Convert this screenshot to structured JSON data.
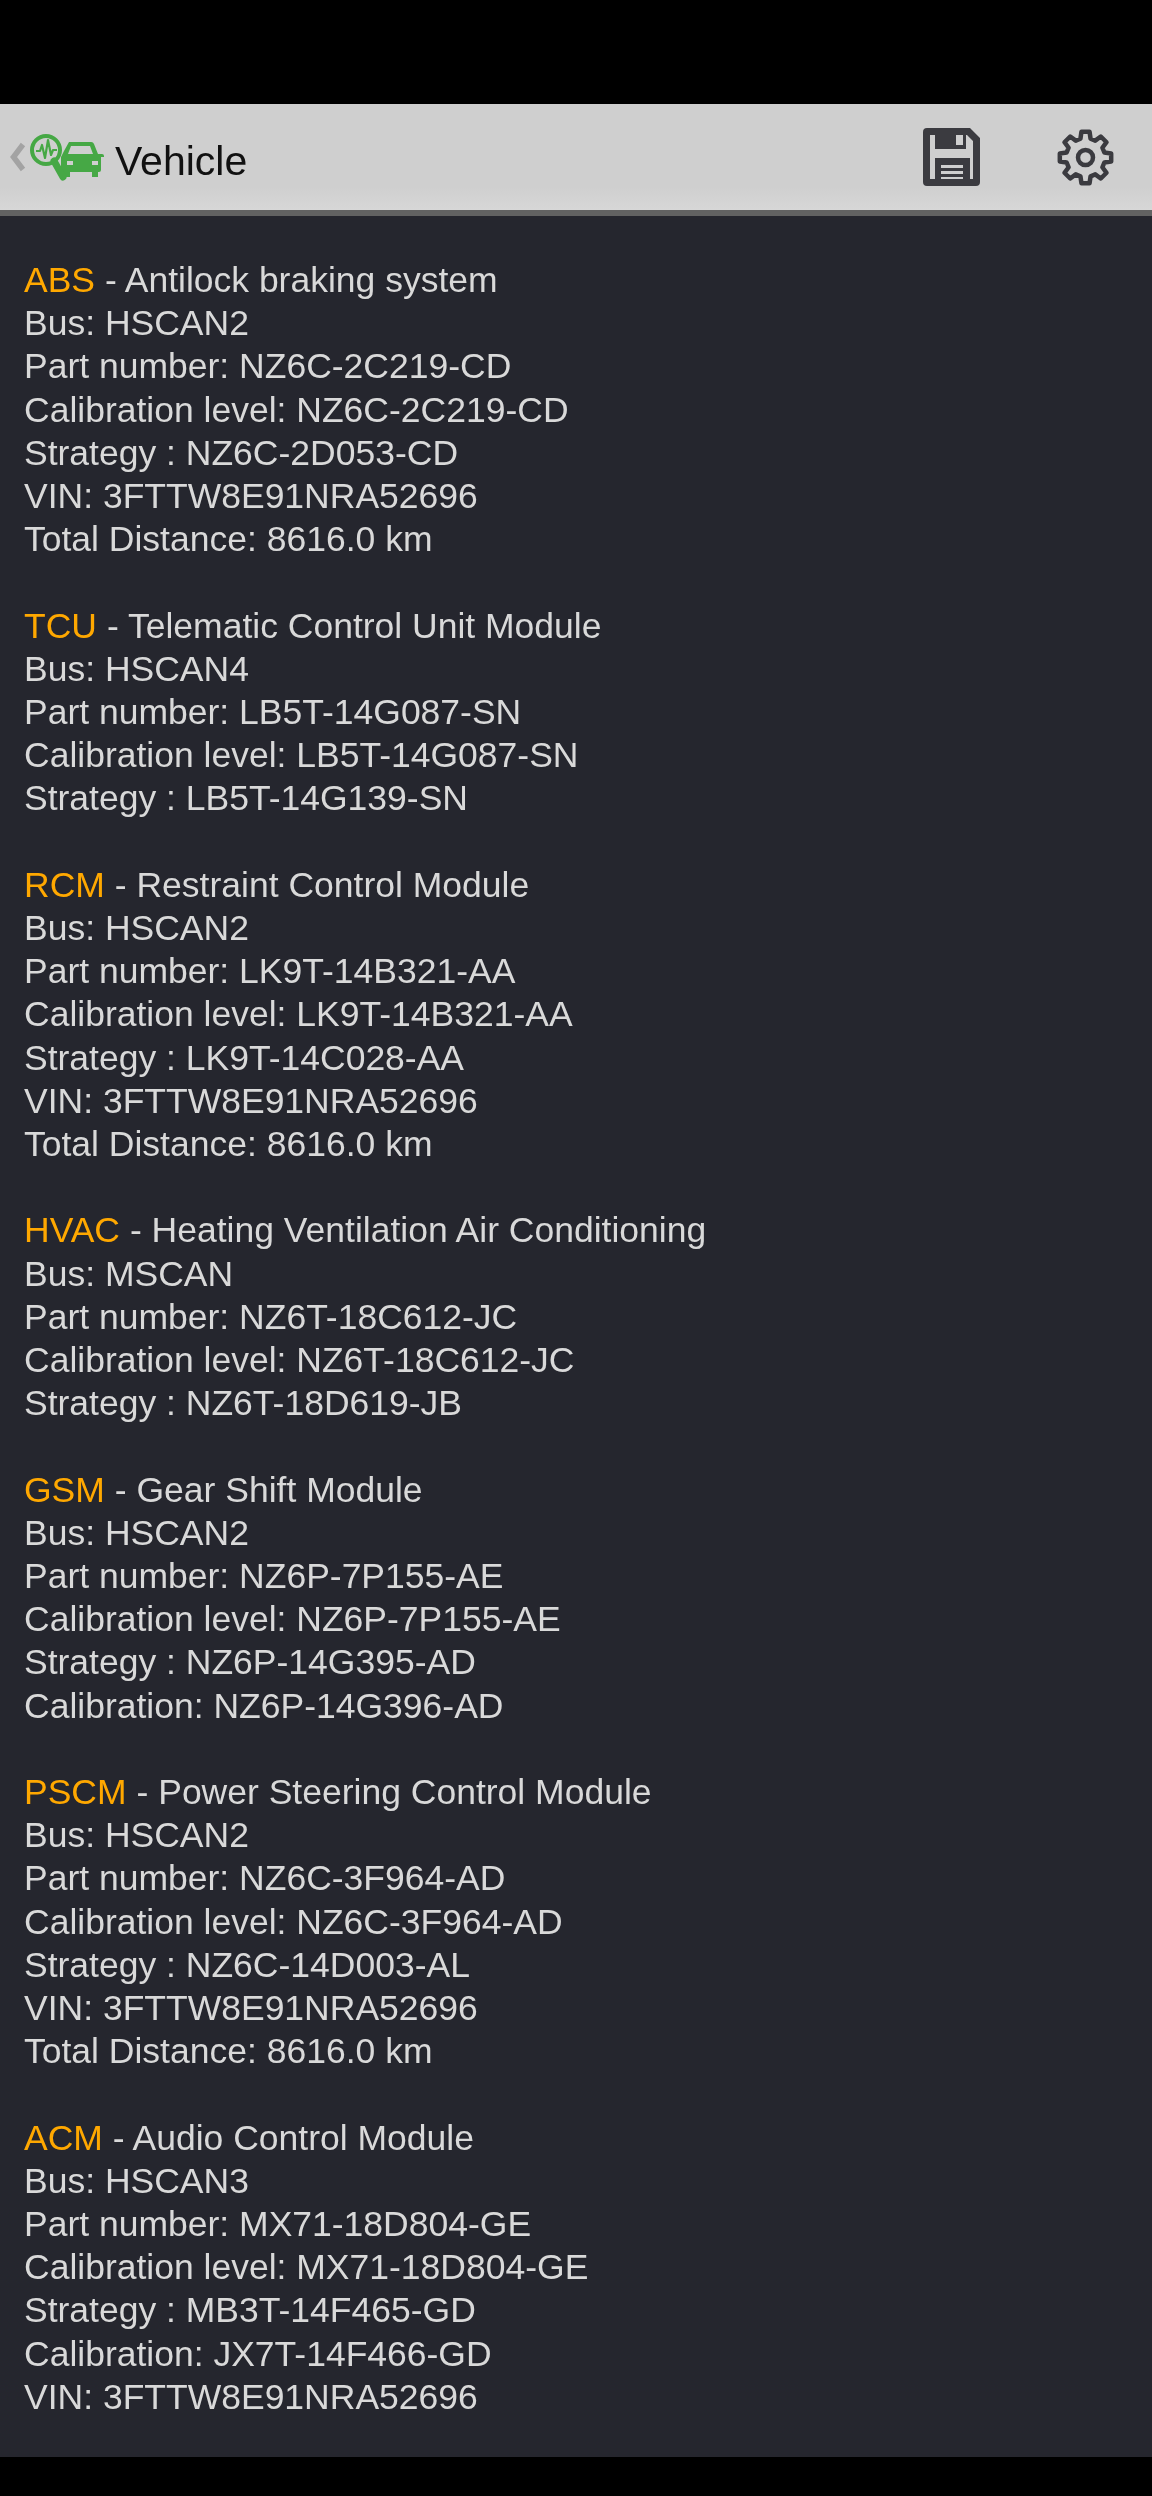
{
  "app_bar": {
    "title": "Vehicle"
  },
  "modules": [
    {
      "code": "ABS",
      "description": "- Antilock braking system",
      "lines": [
        "Bus: HSCAN2",
        "Part number: NZ6C-2C219-CD",
        "Calibration level: NZ6C-2C219-CD",
        "Strategy : NZ6C-2D053-CD",
        "VIN: 3FTTW8E91NRA52696",
        "Total Distance: 8616.0 km"
      ]
    },
    {
      "code": "TCU",
      "description": "- Telematic Control Unit Module",
      "lines": [
        "Bus: HSCAN4",
        "Part number: LB5T-14G087-SN",
        "Calibration level: LB5T-14G087-SN",
        "Strategy : LB5T-14G139-SN"
      ]
    },
    {
      "code": "RCM",
      "description": "- Restraint Control Module",
      "lines": [
        "Bus: HSCAN2",
        "Part number: LK9T-14B321-AA",
        "Calibration level: LK9T-14B321-AA",
        "Strategy : LK9T-14C028-AA",
        "VIN: 3FTTW8E91NRA52696",
        "Total Distance: 8616.0 km"
      ]
    },
    {
      "code": "HVAC",
      "description": "- Heating Ventilation Air Conditioning",
      "lines": [
        "Bus: MSCAN",
        "Part number: NZ6T-18C612-JC",
        "Calibration level: NZ6T-18C612-JC",
        "Strategy : NZ6T-18D619-JB"
      ]
    },
    {
      "code": "GSM",
      "description": "- Gear Shift Module",
      "lines": [
        "Bus: HSCAN2",
        "Part number: NZ6P-7P155-AE",
        "Calibration level: NZ6P-7P155-AE",
        "Strategy : NZ6P-14G395-AD",
        "Calibration: NZ6P-14G396-AD"
      ]
    },
    {
      "code": "PSCM",
      "description": "- Power Steering Control Module",
      "lines": [
        "Bus: HSCAN2",
        "Part number: NZ6C-3F964-AD",
        "Calibration level: NZ6C-3F964-AD",
        "Strategy : NZ6C-14D003-AL",
        "VIN: 3FTTW8E91NRA52696",
        "Total Distance: 8616.0 km"
      ]
    },
    {
      "code": "ACM",
      "description": "- Audio Control Module",
      "lines": [
        "Bus: HSCAN3",
        "Part number: MX71-18D804-GE",
        "Calibration level: MX71-18D804-GE",
        "Strategy : MB3T-14F465-GD",
        "Calibration: JX7T-14F466-GD",
        "VIN: 3FTTW8E91NRA52696"
      ]
    }
  ]
}
